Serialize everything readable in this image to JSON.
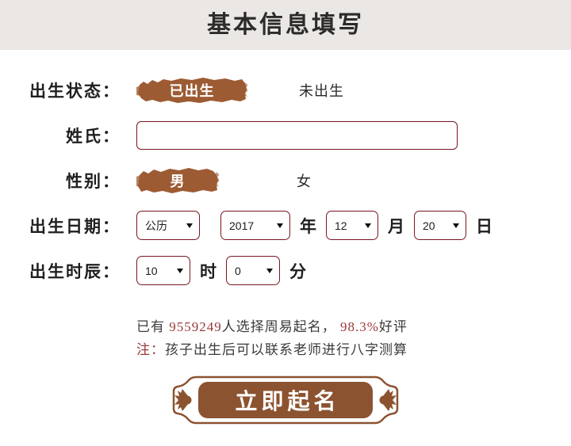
{
  "header": {
    "title": "基本信息填写",
    "background_color": "#ebe7e4"
  },
  "theme": {
    "brush_color": "#9d5b33",
    "border_color": "#7a1520",
    "accent_color": "#9b3a3a",
    "plaque_color": "#8c5330"
  },
  "form": {
    "rows": [
      {
        "label": "出生状态：",
        "options": [
          {
            "text": "已出生",
            "selected": true
          },
          {
            "text": "未出生",
            "selected": false
          }
        ]
      },
      {
        "label": "姓氏：",
        "input": {
          "value": "",
          "placeholder": ""
        }
      },
      {
        "label": "性别：",
        "options": [
          {
            "text": "男",
            "selected": true
          },
          {
            "text": "女",
            "selected": false
          }
        ]
      },
      {
        "label": "出生日期：",
        "selects": [
          {
            "name": "calendar",
            "value": "公历"
          },
          {
            "name": "year",
            "value": "2017",
            "unit": "年"
          },
          {
            "name": "month",
            "value": "12",
            "unit": "月"
          },
          {
            "name": "day",
            "value": "20",
            "unit": "日"
          }
        ]
      },
      {
        "label": "出生时辰：",
        "selects": [
          {
            "name": "hour",
            "value": "10",
            "unit": "时"
          },
          {
            "name": "minute",
            "value": "0",
            "unit": "分"
          }
        ]
      }
    ]
  },
  "notes": {
    "stats_prefix": "已有 ",
    "stats_count": "9559249",
    "stats_middle": "人选择周易起名， ",
    "stats_rating": "98.3%",
    "stats_suffix": "好评",
    "note_label": "注：",
    "note_text": "孩子出生后可以联系老师进行八字测算"
  },
  "submit": {
    "label": "立即起名"
  }
}
